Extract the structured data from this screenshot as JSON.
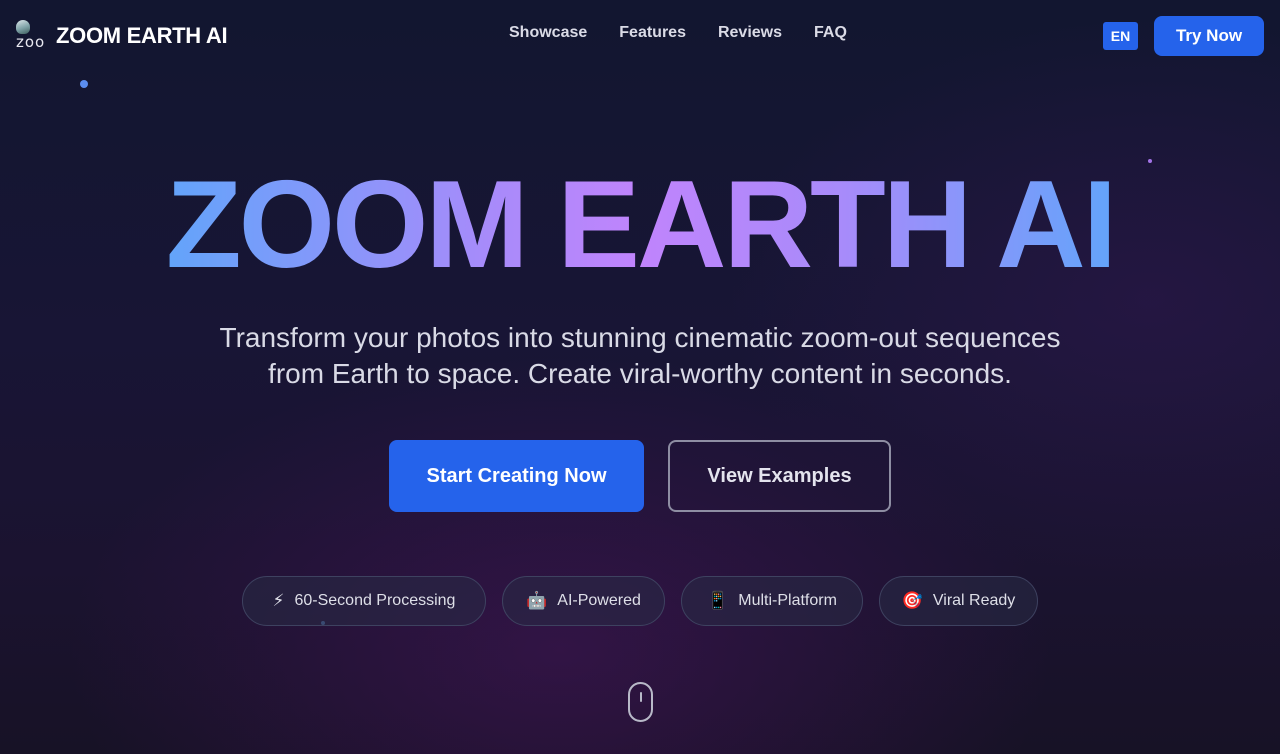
{
  "nav": {
    "logo_alt": "zoo",
    "brand": "ZOOM EARTH AI",
    "links": [
      "Showcase",
      "Features",
      "Reviews",
      "FAQ"
    ],
    "lang": "EN",
    "try_now": "Try Now"
  },
  "hero": {
    "title": "ZOOM EARTH AI",
    "subtitle_line1": "Transform your photos into stunning cinematic zoom-out sequences",
    "subtitle_line2": "from Earth to space. Create viral-worthy content in seconds.",
    "cta_primary": "Start Creating Now",
    "cta_secondary": "View Examples"
  },
  "features": [
    {
      "icon": "lightning-icon",
      "glyph": "⚡",
      "label": "60-Second Processing"
    },
    {
      "icon": "robot-icon",
      "glyph": "🤖",
      "label": "AI-Powered"
    },
    {
      "icon": "mobile-phone-icon",
      "glyph": "📱",
      "label": "Multi-Platform"
    },
    {
      "icon": "target-icon",
      "glyph": "🎯",
      "label": "Viral Ready"
    }
  ],
  "colors": {
    "accent": "#2563eb",
    "title_gradient": [
      "#60a5fa",
      "#a78bfa",
      "#c084fc"
    ],
    "background": "#161632"
  }
}
